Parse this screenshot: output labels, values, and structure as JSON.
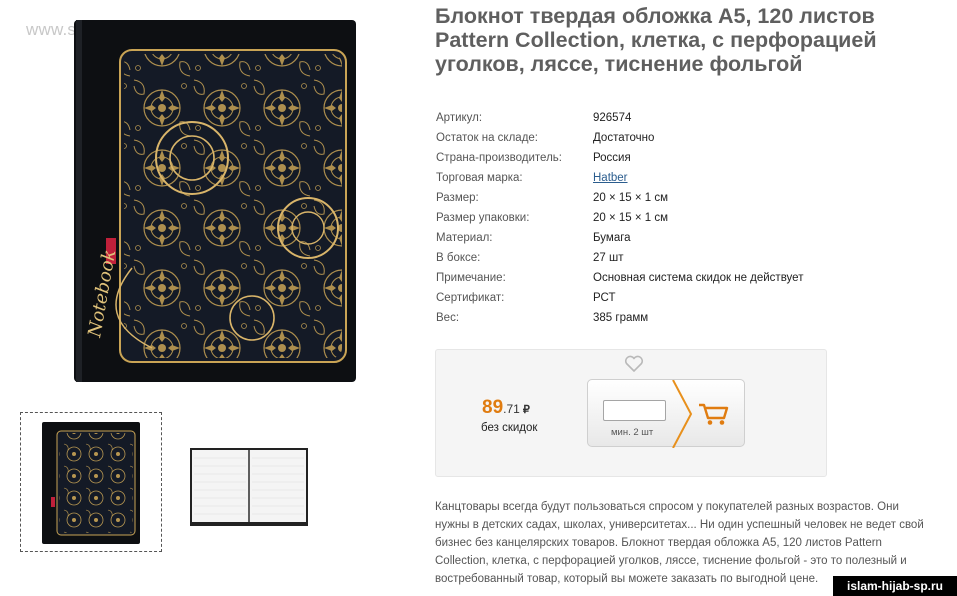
{
  "watermark": "www.sima-land.ru",
  "product": {
    "title": "Блокнот твердая обложка А5, 120 листов Pattern Collection, клетка, с перфорацией уголков, ляссе, тиснение фольгой"
  },
  "specs": [
    {
      "label": "Артикул:",
      "value": "926574"
    },
    {
      "label": "Остаток на складе:",
      "value": "Достаточно"
    },
    {
      "label": "Страна-производитель:",
      "value": "Россия"
    },
    {
      "label": "Торговая марка:",
      "value": "Hatber"
    },
    {
      "label": "Размер:",
      "value": "20 × 15 × 1 см"
    },
    {
      "label": "Размер упаковки:",
      "value": "20 × 15 × 1 см"
    },
    {
      "label": "Материал:",
      "value": "Бумага"
    },
    {
      "label": "В боксе:",
      "value": "27 шт"
    },
    {
      "label": "Примечание:",
      "value": "Основная система скидок не действует"
    },
    {
      "label": "Сертификат:",
      "value": "РСТ"
    },
    {
      "label": "Вес:",
      "value": "385 грамм"
    }
  ],
  "buy": {
    "price_main": "89",
    "price_fraction": ".71",
    "currency": "₽",
    "no_discount": "без скидок",
    "quantity_value": "",
    "min_qty": "мин. 2 шт"
  },
  "description": "Канцтовары всегда будут пользоваться спросом у покупателей разных возрастов. Они нужны в детских садах, школах, университетах... Ни один успешный человек не ведет свой бизнес без канцелярских товаров. Блокнот твердая обложка А5, 120 листов Pattern Collection, клетка, с перфорацией уголков, ляссе, тиснение фольгой - это то полезный и востребованный товар, который вы можете заказать по выгодной цене.",
  "cover_text": "Notebook",
  "badge": "islam-hijab-sp.ru",
  "colors": {
    "price": "#e07c10",
    "link": "#2b5d8e",
    "cover": "#111317",
    "gold": "#c9a455"
  },
  "icons": [
    "heart-icon",
    "cart-icon",
    "chevron-icon"
  ]
}
